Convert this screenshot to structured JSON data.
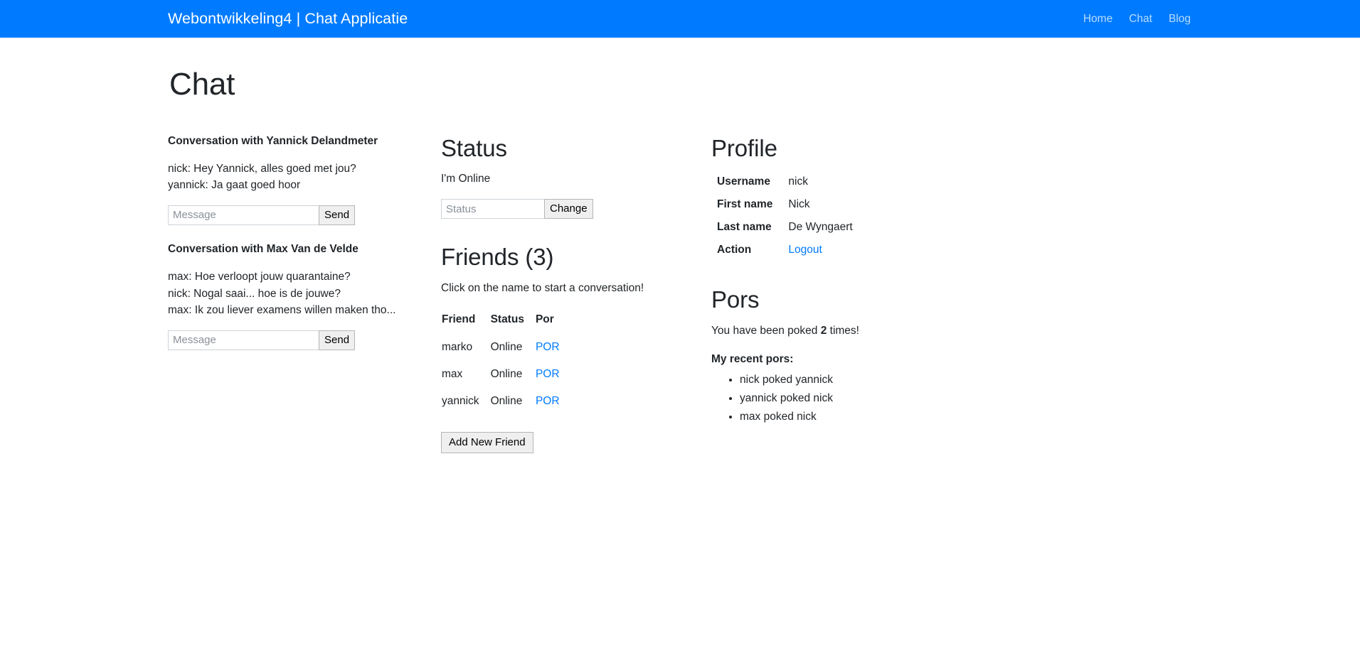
{
  "navbar": {
    "brand": "Webontwikkeling4 | Chat Applicatie",
    "links": [
      {
        "label": "Home"
      },
      {
        "label": "Chat"
      },
      {
        "label": "Blog"
      }
    ],
    "brand_color": "#ffffff",
    "background_color": "#007bff"
  },
  "page": {
    "title": "Chat"
  },
  "conversations": [
    {
      "title": "Conversation with Yannick Delandmeter",
      "messages": [
        "nick: Hey Yannick, alles goed met jou?",
        "yannick: Ja gaat goed hoor"
      ],
      "input_placeholder": "Message",
      "input_value": "",
      "send_label": "Send"
    },
    {
      "title": "Conversation with Max Van de Velde",
      "messages": [
        "max: Hoe verloopt jouw quarantaine?",
        "nick: Nogal saai... hoe is de jouwe?",
        "max: Ik zou liever examens willen maken tho..."
      ],
      "input_placeholder": "Message",
      "input_value": "",
      "send_label": "Send"
    }
  ],
  "status": {
    "heading": "Status",
    "current": "I'm Online",
    "input_placeholder": "Status",
    "input_value": "",
    "change_label": "Change"
  },
  "friends": {
    "heading": "Friends (3)",
    "hint": "Click on the name to start a conversation!",
    "columns": [
      "Friend",
      "Status",
      "Por"
    ],
    "rows": [
      {
        "name": "marko",
        "status": "Online",
        "por": "POR"
      },
      {
        "name": "max",
        "status": "Online",
        "por": "POR"
      },
      {
        "name": "yannick",
        "status": "Online",
        "por": "POR"
      }
    ],
    "add_label": "Add New Friend",
    "link_color": "#007bff"
  },
  "profile": {
    "heading": "Profile",
    "fields": [
      {
        "label": "Username",
        "value": "nick"
      },
      {
        "label": "First name",
        "value": "Nick"
      },
      {
        "label": "Last name",
        "value": "De Wyngaert"
      }
    ],
    "action_label": "Action",
    "logout_label": "Logout"
  },
  "pors": {
    "heading": "Pors",
    "count_prefix": "You have been poked ",
    "count": "2",
    "count_suffix": " times!",
    "recent_heading": "My recent pors:",
    "recent": [
      "nick poked yannick",
      "yannick poked nick",
      "max poked nick"
    ]
  }
}
